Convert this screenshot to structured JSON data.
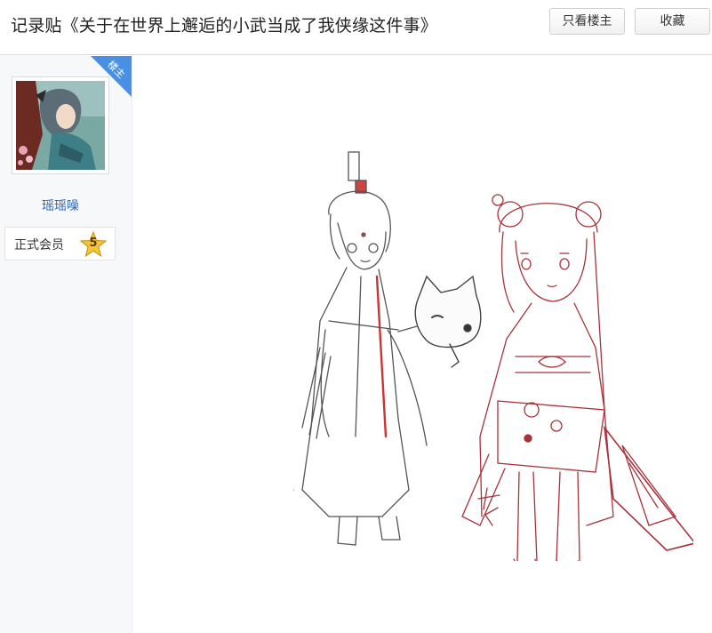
{
  "header": {
    "title": "记录贴《关于在世界上邂逅的小武当成了我侠缘这件事》",
    "only_op_label": "只看楼主",
    "collect_label": "收藏"
  },
  "sidebar": {
    "op_badge": "楼主",
    "username": "瑶瑶噪",
    "member_label": "正式会员",
    "level": "5"
  },
  "colors": {
    "ribbon": "#4a90e2",
    "username": "#2d64b3",
    "level_badge": "#f5c23a",
    "sketch_red": "#a8323a"
  }
}
